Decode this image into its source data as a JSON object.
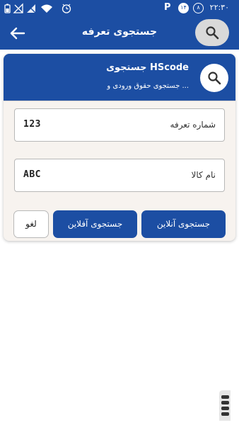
{
  "status_bar": {
    "time": "۲۲:۳۰",
    "notification_count": "۱۴",
    "alarm_badge": "۸",
    "p_icon": "P"
  },
  "app_bar": {
    "title": "جستجوی تعرفه",
    "back_icon": "arrow-left-icon",
    "search_icon": "search-icon"
  },
  "card": {
    "title": "جستجوی HScode",
    "subtitle": "جستجوی حقوق ورودی و ...",
    "fields": [
      {
        "label": "شماره تعرفه",
        "tag": "123"
      },
      {
        "label": "نام کالا",
        "tag": "ABC"
      }
    ],
    "buttons": {
      "online": "جستجوی آنلاین",
      "offline": "جستجوی آفلاین",
      "cancel": "لغو"
    }
  },
  "colors": {
    "primary": "#1c4ea3",
    "card_bg": "#f7f3ef",
    "search_pill": "#d9d9d9"
  }
}
